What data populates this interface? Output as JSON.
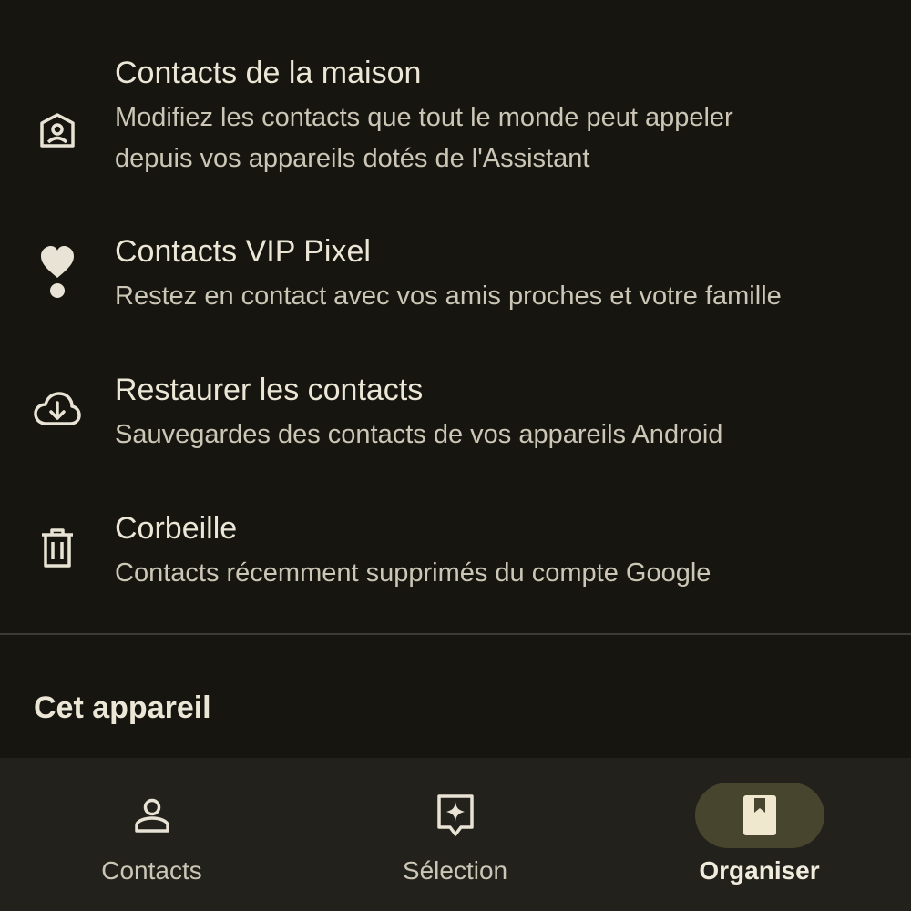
{
  "menu": {
    "items": [
      {
        "title": "Contacts de la maison",
        "subtitle_lines": [
          "Modifiez les contacts que tout le monde peut appeler",
          "depuis vos appareils dotés de l'Assistant"
        ],
        "icon": "home-contact-icon"
      },
      {
        "title": "Contacts VIP Pixel",
        "subtitle_lines": [
          "Restez en contact avec vos amis proches et votre famille"
        ],
        "icon": "heart-person-icon"
      },
      {
        "title": "Restaurer les contacts",
        "subtitle_lines": [
          "Sauvegardes des contacts de vos appareils Android"
        ],
        "icon": "cloud-download-icon"
      },
      {
        "title": "Corbeille",
        "subtitle_lines": [
          "Contacts récemment supprimés du compte Google"
        ],
        "icon": "trash-icon"
      }
    ]
  },
  "section": {
    "title": "Cet appareil"
  },
  "bottom_nav": {
    "items": [
      {
        "label": "Contacts",
        "icon": "person-icon",
        "active": false
      },
      {
        "label": "Sélection",
        "icon": "sparkle-bubble-icon",
        "active": false
      },
      {
        "label": "Organiser",
        "icon": "bookmark-book-icon",
        "active": true
      }
    ]
  },
  "colors": {
    "background": "#16150f",
    "nav_background": "#22211b",
    "active_pill": "#48452f",
    "text_primary": "#ebe6d6",
    "text_secondary": "#cbc6b6"
  }
}
